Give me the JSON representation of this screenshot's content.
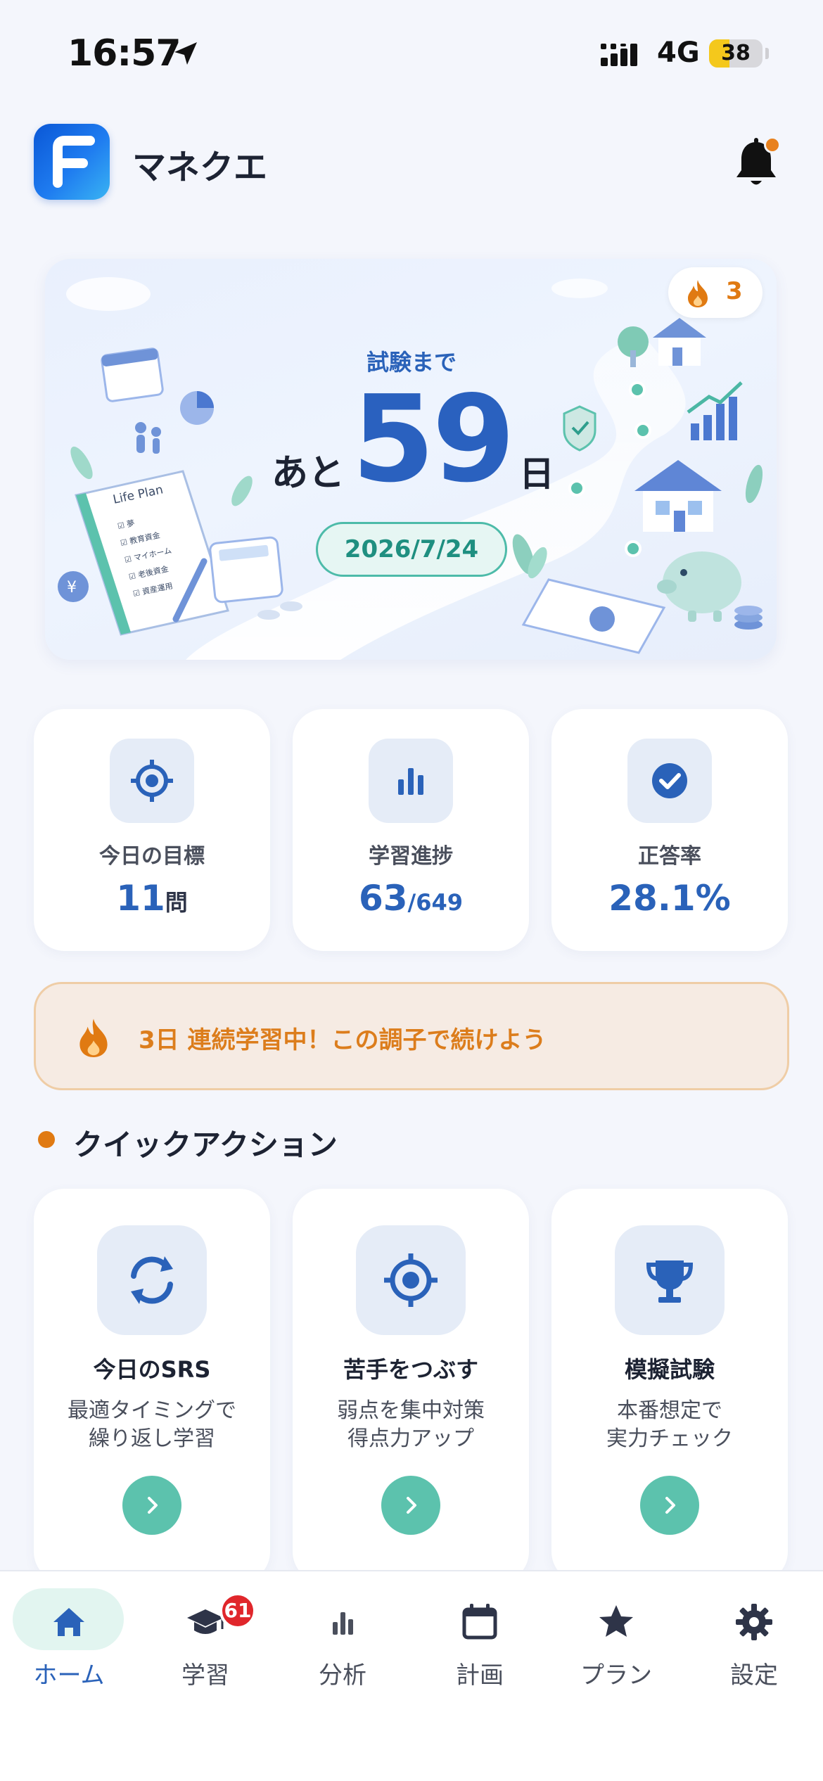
{
  "status_bar": {
    "time": "16:57",
    "network": "4G",
    "battery_percent": 38,
    "battery_label": "38"
  },
  "header": {
    "app_title": "マネクエ",
    "logo_letter": "F",
    "notification_dot": true
  },
  "hero": {
    "streak_count": "3",
    "exam_label": "試験まで",
    "prefix": "あと",
    "days": "59",
    "suffix": "日",
    "exam_date": "2026/7/24",
    "illustration_notebook_title": "Life Plan",
    "illustration_notebook_items": [
      "夢",
      "教育資金",
      "マイホーム",
      "老後資金",
      "資産運用"
    ]
  },
  "stats": [
    {
      "label": "今日の目標",
      "value": "11",
      "unit": "問",
      "icon": "target-icon"
    },
    {
      "label": "学習進捗",
      "value": "63",
      "unit": "/649",
      "icon": "bar-chart-icon"
    },
    {
      "label": "正答率",
      "value": "28.1%",
      "unit": "",
      "icon": "check-circle-icon"
    }
  ],
  "streak_banner": {
    "text": "3日 連続学習中！この調子で続けよう"
  },
  "quick_actions": {
    "section_title": "クイックアクション",
    "items": [
      {
        "title": "今日のSRS",
        "desc_line1": "最適タイミングで",
        "desc_line2": "繰り返し学習",
        "icon": "refresh-icon"
      },
      {
        "title": "苦手をつぶす",
        "desc_line1": "弱点を集中対策",
        "desc_line2": "得点力アップ",
        "icon": "target-icon"
      },
      {
        "title": "模擬試験",
        "desc_line1": "本番想定で",
        "desc_line2": "実力チェック",
        "icon": "trophy-icon"
      }
    ]
  },
  "tabbar": {
    "items": [
      {
        "label": "ホーム",
        "icon": "home-icon",
        "active": true
      },
      {
        "label": "学習",
        "icon": "graduation-cap-icon",
        "badge": "61"
      },
      {
        "label": "分析",
        "icon": "bar-chart-icon"
      },
      {
        "label": "計画",
        "icon": "calendar-icon"
      },
      {
        "label": "プラン",
        "icon": "star-icon"
      },
      {
        "label": "設定",
        "icon": "gear-icon"
      }
    ]
  },
  "colors": {
    "primary_blue": "#2a62b9",
    "accent_orange": "#e07a12",
    "teal": "#5cc2ad",
    "background": "#f4f6fc"
  }
}
